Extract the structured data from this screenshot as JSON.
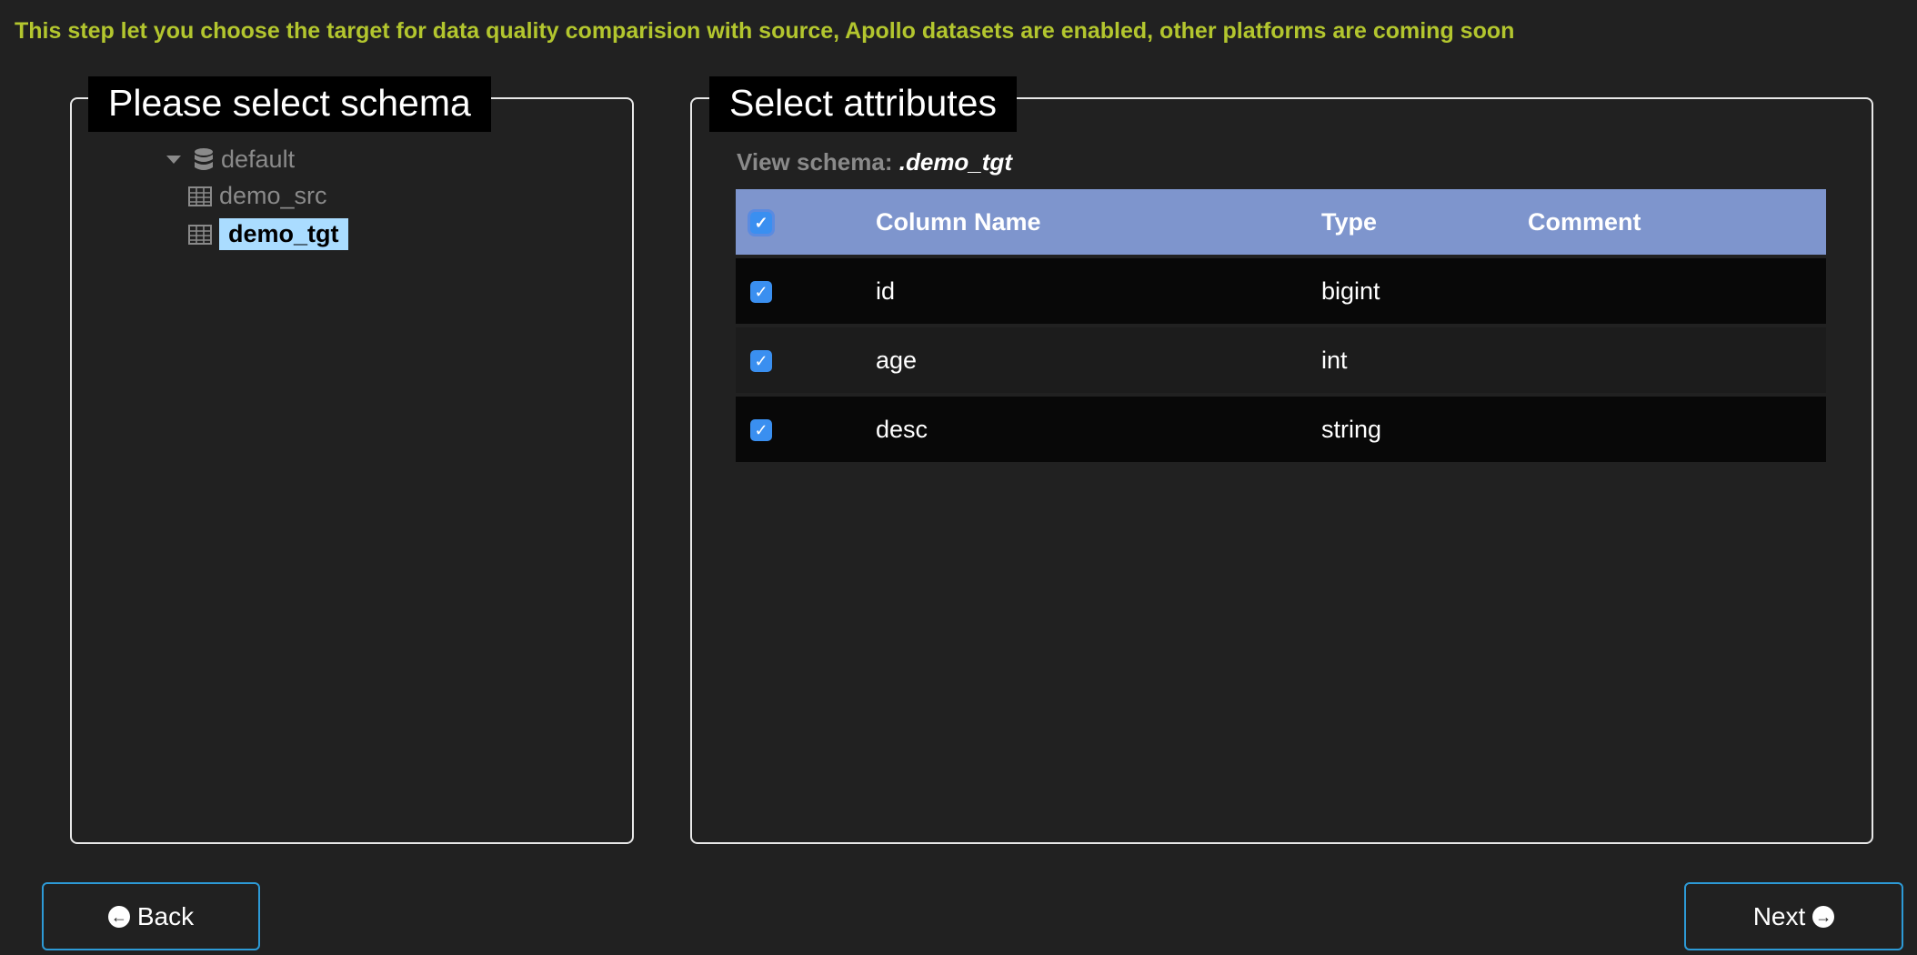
{
  "hint": "This step let you choose the target for data quality comparision with source, Apollo datasets are enabled, other platforms are coming soon",
  "schema_panel": {
    "title": "Please select schema",
    "tree": {
      "database": "default",
      "tables": [
        "demo_src",
        "demo_tgt"
      ],
      "selected": "demo_tgt"
    }
  },
  "attributes_panel": {
    "title": "Select attributes",
    "view_schema_label": "View schema:",
    "view_schema_value": ".demo_tgt",
    "columns": [
      "Column Name",
      "Type",
      "Comment"
    ],
    "rows": [
      {
        "name": "id",
        "type": "bigint",
        "comment": "",
        "checked": true
      },
      {
        "name": "age",
        "type": "int",
        "comment": "",
        "checked": true
      },
      {
        "name": "desc",
        "type": "string",
        "comment": "",
        "checked": true
      }
    ]
  },
  "buttons": {
    "back": "Back",
    "next": "Next"
  },
  "colors": {
    "hint": "#b3c62e",
    "header": "#7e95cd",
    "selected": "#aadcff",
    "button_border": "#2d9ad6"
  }
}
